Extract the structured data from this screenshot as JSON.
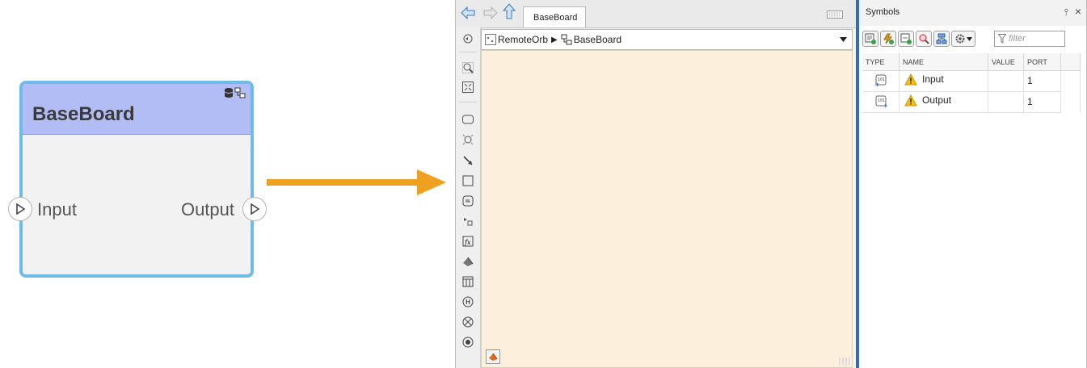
{
  "block": {
    "title": "BaseBoard",
    "input_label": "Input",
    "output_label": "Output"
  },
  "editor": {
    "tab_title": "BaseBoard",
    "breadcrumb": {
      "root": "RemoteOrb",
      "separator": "▶",
      "current": "BaseBoard"
    }
  },
  "symbols_panel": {
    "title": "Symbols",
    "pin_glyph": "⫯",
    "close_glyph": "×",
    "filter_placeholder": "filter",
    "columns": [
      "TYPE",
      "NAME",
      "VALUE",
      "PORT"
    ],
    "rows": [
      {
        "type_icon": "input-port-icon",
        "warning": true,
        "name": "Input",
        "value": "",
        "port": "1"
      },
      {
        "type_icon": "output-port-icon",
        "warning": true,
        "name": "Output",
        "value": "",
        "port": "1"
      }
    ]
  },
  "colors": {
    "block_header": "#b3bdf5",
    "block_border": "#6fbbe8",
    "arrow": "#f0a020",
    "canvas": "#fcf0dc",
    "selection_divider": "#2f6db5",
    "warning": "#f5c211"
  }
}
